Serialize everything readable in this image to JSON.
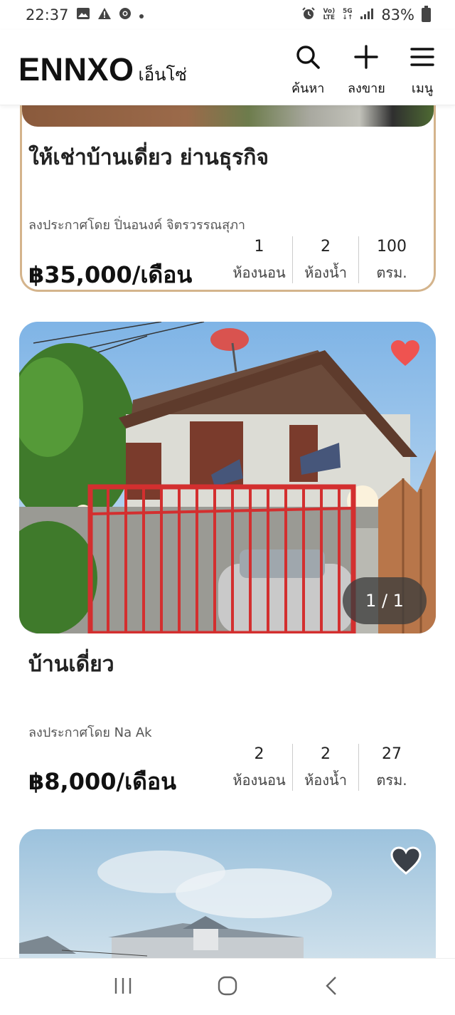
{
  "status_bar": {
    "time": "22:37",
    "battery": "83%",
    "network_top": "Vo)",
    "network_bottom": "LTE",
    "signal_top": "5G",
    "signal_bottom": "↓↑"
  },
  "header": {
    "logo": "ENNXO",
    "logo_sub": "เอ็นโซ่",
    "nav": [
      {
        "label": "ค้นหา",
        "icon": "search-icon"
      },
      {
        "label": "ลงขาย",
        "icon": "plus-icon"
      },
      {
        "label": "เมนู",
        "icon": "menu-icon"
      }
    ]
  },
  "listings": [
    {
      "title": "ให้เช่าบ้านเดี่ยว ย่านธุรกิจ",
      "poster": "ลงประกาศโดย ปิ่นอนงค์ จิตรวรรณสุภา",
      "price": "฿35,000/เดือน",
      "stats": [
        {
          "num": "1",
          "label": "ห้องนอน"
        },
        {
          "num": "2",
          "label": "ห้องน้ำ"
        },
        {
          "num": "100",
          "label": "ตรม."
        }
      ]
    },
    {
      "title": "บ้านเดี่ยว",
      "poster": "ลงประกาศโดย Na Ak",
      "price": "฿8,000/เดือน",
      "pager": "1 / 1",
      "favorited": true,
      "stats": [
        {
          "num": "2",
          "label": "ห้องนอน"
        },
        {
          "num": "2",
          "label": "ห้องน้ำ"
        },
        {
          "num": "27",
          "label": "ตรม."
        }
      ]
    },
    {
      "favorited": false
    }
  ],
  "colors": {
    "featured_border": "#d4b48c",
    "heart_active": "#ef5350",
    "heart_inactive": "#3a3f47"
  }
}
